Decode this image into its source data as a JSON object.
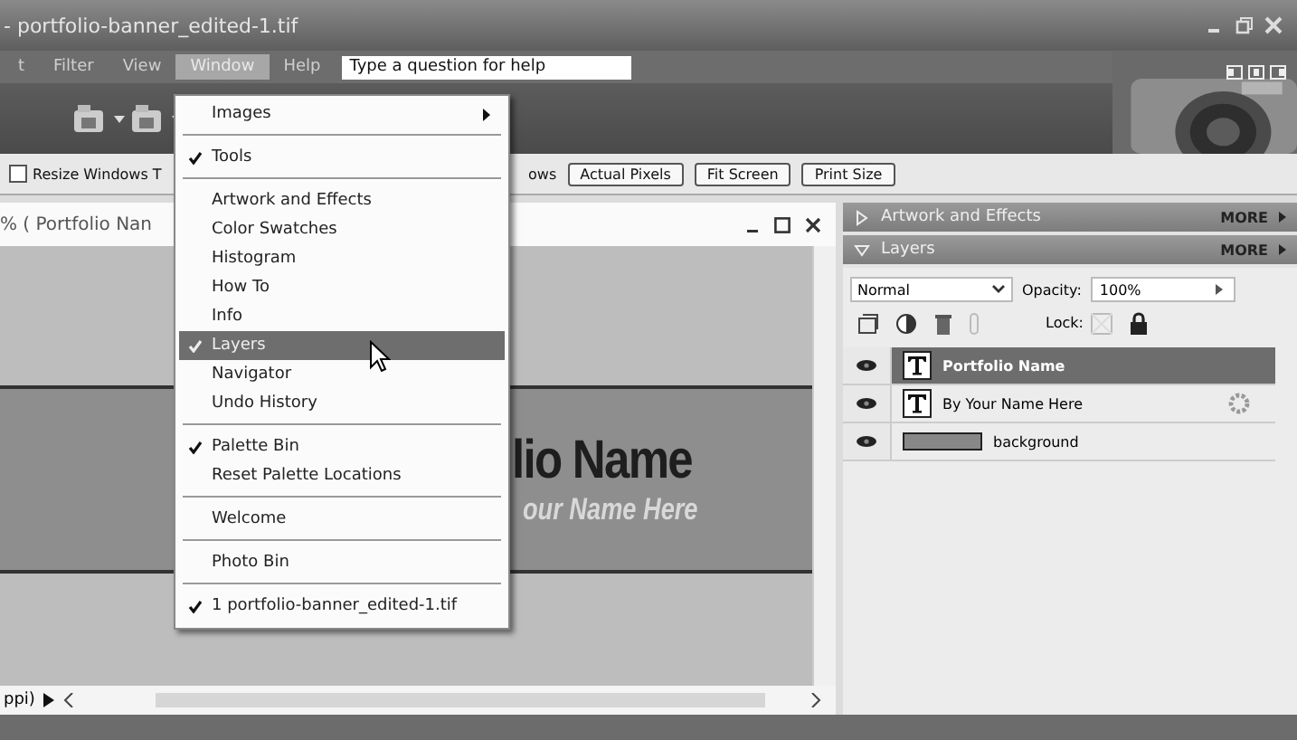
{
  "window": {
    "title": "- portfolio-banner_edited-1.tif"
  },
  "menubar": {
    "items": [
      {
        "label": "t",
        "selected": false
      },
      {
        "label": "Filter",
        "selected": false
      },
      {
        "label": "View",
        "selected": false
      },
      {
        "label": "Window",
        "selected": true
      },
      {
        "label": "Help",
        "selected": false
      }
    ],
    "help_field": {
      "placeholder": "Type a question for help"
    }
  },
  "options_bar": {
    "checkbox": {
      "label": "Resize Windows T",
      "checked": false
    },
    "partial_label": "ows",
    "buttons": [
      "Actual Pixels",
      "Fit Screen",
      "Print Size"
    ]
  },
  "document": {
    "title": "% ( Portfolio Nan",
    "banner_title": "lio Name",
    "banner_subtitle": "our Name Here",
    "status": "ppi)"
  },
  "palettes": [
    {
      "title": "Artwork and Effects",
      "expanded": false,
      "more": "MORE"
    },
    {
      "title": "Layers",
      "expanded": true,
      "more": "MORE"
    }
  ],
  "layers_panel": {
    "blend_mode": "Normal",
    "opacity_label": "Opacity:",
    "opacity": "100%",
    "lock_label": "Lock:",
    "layers": [
      {
        "name": "Portfolio Name",
        "kind": "text",
        "selected": true,
        "visible": true,
        "has_style": false
      },
      {
        "name": "By Your Name Here",
        "kind": "text",
        "selected": false,
        "visible": true,
        "has_style": true
      },
      {
        "name": "background",
        "kind": "fill",
        "selected": false,
        "visible": true,
        "has_style": false
      }
    ]
  },
  "menu": {
    "sections": [
      [
        {
          "label": "Images",
          "checked": false,
          "selected": false,
          "submenu": true
        }
      ],
      [
        {
          "label": "Tools",
          "checked": true,
          "selected": false,
          "submenu": false
        }
      ],
      [
        {
          "label": "Artwork and Effects",
          "checked": false,
          "selected": false,
          "submenu": false
        },
        {
          "label": "Color Swatches",
          "checked": false,
          "selected": false,
          "submenu": false
        },
        {
          "label": "Histogram",
          "checked": false,
          "selected": false,
          "submenu": false
        },
        {
          "label": "How To",
          "checked": false,
          "selected": false,
          "submenu": false
        },
        {
          "label": "Info",
          "checked": false,
          "selected": false,
          "submenu": false
        },
        {
          "label": "Layers",
          "checked": true,
          "selected": true,
          "submenu": false
        },
        {
          "label": "Navigator",
          "checked": false,
          "selected": false,
          "submenu": false
        },
        {
          "label": "Undo History",
          "checked": false,
          "selected": false,
          "submenu": false
        }
      ],
      [
        {
          "label": "Palette Bin",
          "checked": true,
          "selected": false,
          "submenu": false
        },
        {
          "label": "Reset Palette Locations",
          "checked": false,
          "selected": false,
          "submenu": false
        }
      ],
      [
        {
          "label": "Welcome",
          "checked": false,
          "selected": false,
          "submenu": false
        }
      ],
      [
        {
          "label": "Photo Bin",
          "checked": false,
          "selected": false,
          "submenu": false
        }
      ],
      [
        {
          "label": "1 portfolio-banner_edited-1.tif",
          "checked": true,
          "selected": false,
          "submenu": false
        }
      ]
    ]
  }
}
